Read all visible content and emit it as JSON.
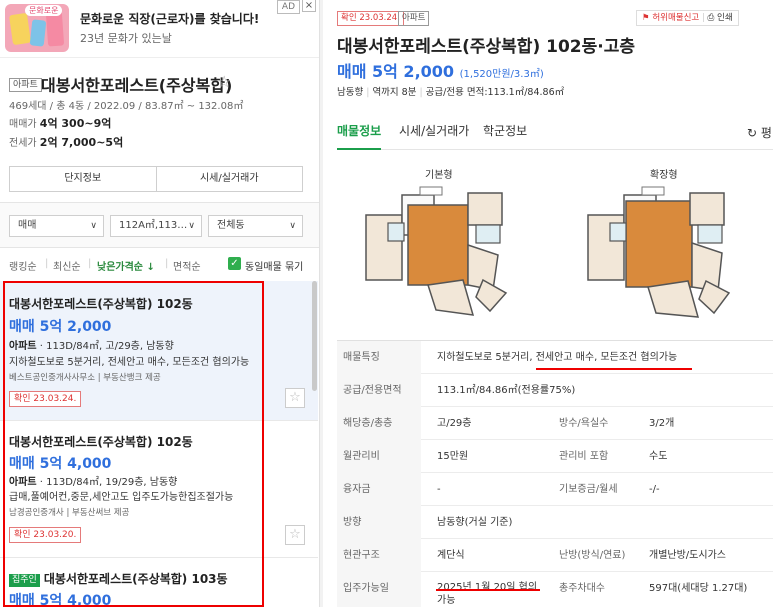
{
  "ad": {
    "thumb_tag": "문화로운",
    "title": "문화로운 직장(근로자)를 찾습니다!",
    "subtitle": "23년 문화가 있는날",
    "badge": "AD",
    "close": "×"
  },
  "complex": {
    "tag": "아파트",
    "name": "대봉서한포레스트(주상복합)",
    "meta": "469세대 / 총 4동 / 2022.09 / 83.87㎡ ~ 132.08㎡",
    "sale_label": "매매가",
    "sale_value": "4억 300~9억",
    "jeonse_label": "전세가",
    "jeonse_value": "2억 7,000~5억",
    "btn_info": "단지정보",
    "btn_price": "시세/실거래가"
  },
  "filters": {
    "trade": "매매",
    "area": "112A㎡,113…",
    "dong": "전체동"
  },
  "sort": {
    "opt1": "랭킹순",
    "opt2": "최신순",
    "opt3": "낮은가격순 ↓",
    "opt4": "면적순",
    "same_label": "동일매물 묶기"
  },
  "listings": [
    {
      "title": "대봉서한포레스트(주상복합) 102동",
      "price": "매매 5억 2,000",
      "type": "아파트",
      "info": " · 113D/84㎡, 고/29층, 남동향",
      "desc": "지하철도보로 5분거리, 전세안고 매수, 모든조건 협의가능",
      "agency": "베스트공인중개사사무소 | 부동산뱅크 제공",
      "verify": "확인 23.03.24."
    },
    {
      "title": "대봉서한포레스트(주상복합) 102동",
      "price": "매매 5억 4,000",
      "type": "아파트",
      "info": " · 113D/84㎡, 19/29층, 남동향",
      "desc": "급매,풀예어컨,중문,세안고도 입주도가능한집조절가능",
      "agency": "남경공인중개사 | 부동산써브 제공",
      "verify": "확인 23.03.20."
    },
    {
      "badge": "집주인",
      "title": "대봉서한포레스트(주상복합) 103동",
      "price": "매매 5억 4,000"
    }
  ],
  "detail": {
    "verify": "확인 23.03.24.",
    "type": "아파트",
    "report": "허위매물신고",
    "print": "인쇄",
    "title": "대봉서한포레스트(주상복합) 102동·고층",
    "price": "매매 5억 2,000",
    "price_per": "(1,520만원/3.3㎡)",
    "sub1": "남동향",
    "sub2": "역까지 8분",
    "sub3": "공급/전용 면적:113.1㎡/84.86㎡",
    "tabs": [
      "매물정보",
      "시세/실거래가",
      "학군정보"
    ],
    "refresh": "↻ 평",
    "plan1": "기본형",
    "plan2": "확장형",
    "rows": [
      {
        "k": "매물특징",
        "v": "지하철도보로 5분거리, 전세안고 매수, 모든조건 협의가능"
      },
      {
        "k": "공급/전용면적",
        "v": "113.1㎡/84.86㎡(전용률75%)"
      },
      {
        "k": "해당층/총층",
        "v": "고/29층",
        "k2": "방수/욕실수",
        "v2": "3/2개"
      },
      {
        "k": "월관리비",
        "v": "15만원",
        "k2": "관리비 포함",
        "v2": "수도"
      },
      {
        "k": "융자금",
        "v": "-",
        "k2": "기보증금/월세",
        "v2": "-/-"
      },
      {
        "k": "방향",
        "v": "남동향(거실 기준)"
      },
      {
        "k": "현관구조",
        "v": "계단식",
        "k2": "난방(방식/연료)",
        "v2": "개별난방/도시가스"
      },
      {
        "k": "입주가능일",
        "v": "2025년 1월 20일 협의",
        "v_b": "가능",
        "k2": "총주차대수",
        "v2": "597대(세대당 1.27대)"
      }
    ]
  }
}
